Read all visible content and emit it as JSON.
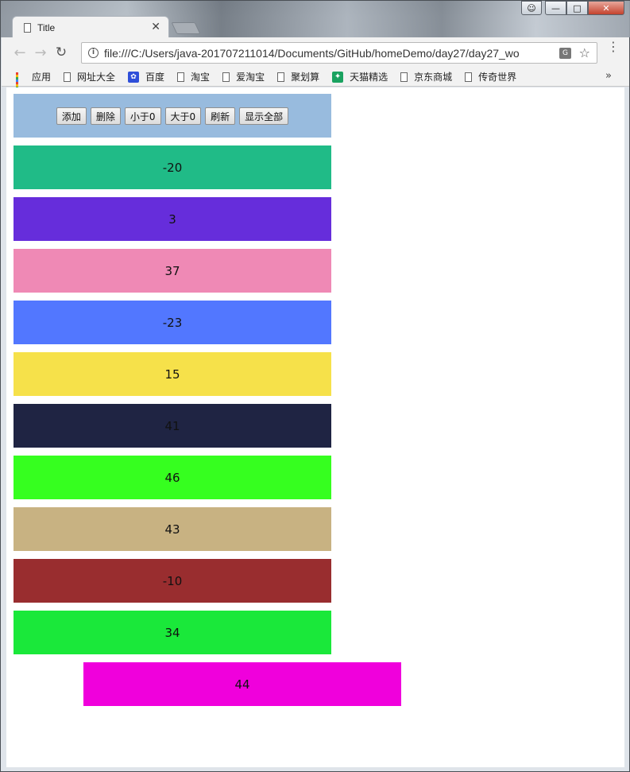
{
  "browser": {
    "tab_title": "Title",
    "url": "file:///C:/Users/java-201707211014/Documents/GitHub/homeDemo/day27/day27_wo",
    "bookmarks": [
      "应用",
      "网址大全",
      "百度",
      "淘宝",
      "爱淘宝",
      "聚划算",
      "天猫精选",
      "京东商城",
      "传奇世界"
    ],
    "bookmarks_more": "»"
  },
  "controls": {
    "add_label": "添加",
    "delete_label": "删除",
    "less_than_zero_label": "小于0",
    "greater_than_zero_label": "大于0",
    "refresh_label": "刷新",
    "show_all_label": "显示全部"
  },
  "boxes": [
    {
      "value": "-20",
      "color": "#20bb87"
    },
    {
      "value": "3",
      "color": "#662ddb"
    },
    {
      "value": "37",
      "color": "#ef89b5"
    },
    {
      "value": "-23",
      "color": "#5277ff"
    },
    {
      "value": "15",
      "color": "#f6e14a"
    },
    {
      "value": "41",
      "color": "#1f2443"
    },
    {
      "value": "46",
      "color": "#36ff1f"
    },
    {
      "value": "43",
      "color": "#c8b282"
    },
    {
      "value": "-10",
      "color": "#992d2f"
    },
    {
      "value": "34",
      "color": "#1ae83a"
    },
    {
      "value": "44",
      "color": "#f000dc"
    }
  ]
}
